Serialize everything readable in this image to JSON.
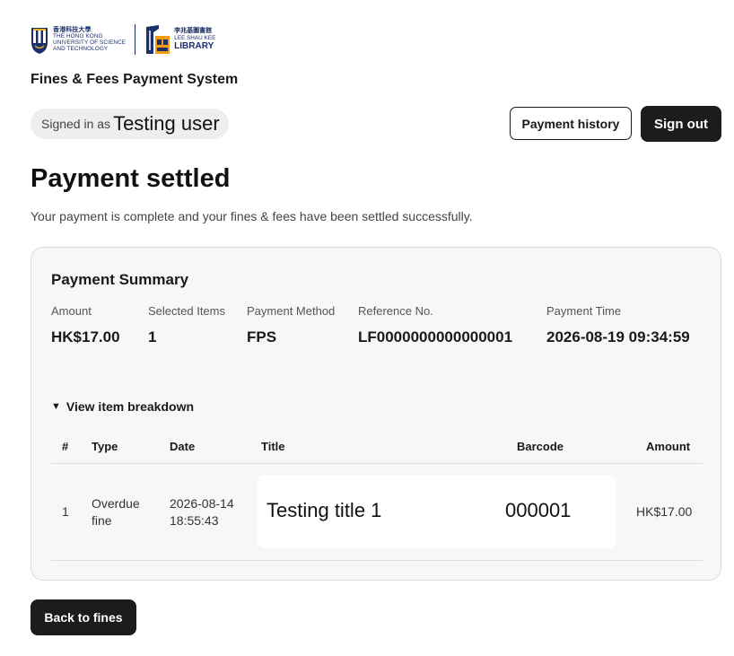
{
  "branding": {
    "hkust_cn": "香港科技大學",
    "hkust_line1": "THE HONG KONG",
    "hkust_line2": "UNIVERSITY OF SCIENCE",
    "hkust_line3": "AND TECHNOLOGY",
    "library_cn": "李兆基圖書館",
    "library_line1": "LEE SHAU KEE",
    "library_line2": "LIBRARY"
  },
  "header": {
    "app_title": "Fines & Fees Payment System",
    "signed_in_label": "Signed in as",
    "user_name": "Testing user",
    "payment_history_label": "Payment history",
    "sign_out_label": "Sign out"
  },
  "main": {
    "heading": "Payment settled",
    "subtext": "Your payment is complete and your fines & fees have been settled successfully."
  },
  "summary": {
    "title": "Payment Summary",
    "amount_label": "Amount",
    "amount_value": "HK$17.00",
    "items_label": "Selected Items",
    "items_value": "1",
    "method_label": "Payment Method",
    "method_value": "FPS",
    "ref_label": "Reference No.",
    "ref_value": "LF0000000000000001",
    "time_label": "Payment Time",
    "time_value": "2026-08-19 09:34:59"
  },
  "breakdown": {
    "toggle_icon": "▼",
    "toggle_label": "View item breakdown",
    "columns": {
      "num": "#",
      "type": "Type",
      "date": "Date",
      "title": "Title",
      "barcode": "Barcode",
      "amount": "Amount"
    },
    "rows": [
      {
        "num": "1",
        "type_line1": "Overdue",
        "type_line2": "fine",
        "date_line1": "2026-08-14",
        "date_line2": "18:55:43",
        "title": "Testing title 1",
        "barcode": "000001",
        "amount": "HK$17.00"
      }
    ]
  },
  "footer": {
    "back_label": "Back to fines"
  },
  "colors": {
    "primary_dark": "#1c1c1c",
    "brand_navy": "#1b2f6b",
    "brand_orange": "#f39c12",
    "card_bg": "#f6f7f8"
  }
}
